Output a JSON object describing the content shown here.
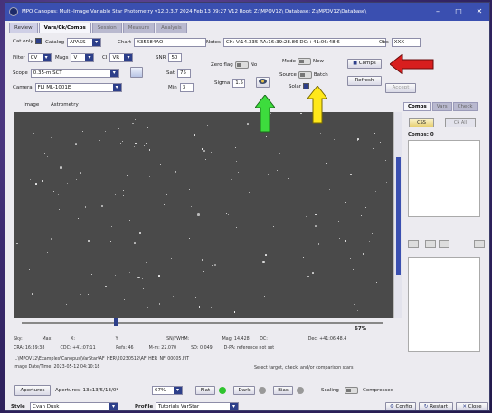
{
  "window": {
    "title": "MPO Canopus: Multi-Image Variable Star Photometry  v12.0.3.7  2024 Feb 13  09:27    V12 Root: Z:\\MPOV12\\  Database: Z:\\MPOV12\\Database\\",
    "minimize": "–",
    "maximize": "□",
    "close": "✕"
  },
  "tabs": [
    {
      "label": "Review"
    },
    {
      "label": "Vars/Ck/Comps"
    },
    {
      "label": "Session"
    },
    {
      "label": "Measure"
    },
    {
      "label": "Analysis"
    }
  ],
  "controls": {
    "cat_only": "Cat only",
    "catalog_label": "Catalog",
    "catalog_value": "APASS",
    "chart_label": "Chart",
    "chart_value": "X35684AO",
    "notes_label": "Notes",
    "notes_value": "CK: V:14.335 RA:16:39:28.86 DC:+41:06:48.6",
    "obs_label": "Obs",
    "obs_value": "XXX",
    "filter_label": "Filter",
    "filter_value": "CV",
    "mags_label": "Mags",
    "mags_value": "V",
    "ci_label": "CI",
    "ci_value": "VR",
    "snr_label": "SNR",
    "snr_value": "50",
    "scope_label": "Scope",
    "scope_value": "0.35-m SCT",
    "sat_label": "Sat",
    "sat_value": "75",
    "camera_label": "Camera",
    "camera_value": "FLI ML-1001E",
    "min_label": "Min",
    "min_value": "3",
    "zero_flag_label": "Zero flag",
    "zero_flag_value": "No",
    "sigma_label": "Sigma",
    "sigma_value": "1.5",
    "mode_label": "Mode",
    "mode_value": "New",
    "source_label": "Source",
    "source_value": "Batch",
    "solar_label": "Solar",
    "comps_button": "Comps",
    "refresh_button": "Refresh",
    "accept_button": "Accept"
  },
  "image_tabs": [
    {
      "label": "Image"
    },
    {
      "label": "Astrometry"
    }
  ],
  "right_panel": {
    "tabs": [
      {
        "label": "Comps"
      },
      {
        "label": "Vars"
      },
      {
        "label": "Check"
      }
    ],
    "css_button": "CSS",
    "checkall_button": "Ck All",
    "comps_count": "Comps: 0"
  },
  "zoom": {
    "value": "67%"
  },
  "status": {
    "row1": [
      "Sky:",
      "Max:",
      "X:",
      "Y:",
      "SN/FWHM:",
      "Mag: 14.428",
      "DC:",
      "Dec: +41:06:48.4"
    ],
    "row2": [
      "CRA: 16:39:38",
      "CDC: +41:07:11",
      "Refs: 46",
      "M-m: 22.070",
      "SD: 0.049",
      "D-PA: reference not set"
    ],
    "file": "...\\MPOV12\\Examples\\Canopus\\VarStar\\AF_HER\\20230512\\AF_HER_NF_00005.FIT",
    "datetime": "Image Date/Time: 2023-05-12  04:10:18",
    "hint": "Select target, check, and/or comparison stars"
  },
  "bottom": {
    "apertures_button": "Apertures",
    "apertures_label": "Apertures: 13x13/5/13/0*",
    "zoom_value": "67%",
    "flat_button": "Flat",
    "dark_button": "Dark",
    "bias_button": "Bias",
    "scaling_label": "Scaling",
    "compressed_label": "Compressed",
    "style_label": "Style",
    "style_value": "Cyan Dusk",
    "profile_label": "Profile",
    "profile_value": "Tutorials VarStar",
    "config_button": "Config",
    "restart_button": "Restart",
    "close_button": "Close"
  },
  "colors": {
    "titlebar": "#3a4fb0",
    "accent": "#2d3f8a",
    "image_bg": "#4a4a4a",
    "red_arrow": "#d81e1e",
    "green_arrow": "#3ddc3d",
    "yellow_arrow": "#ffe81a"
  }
}
